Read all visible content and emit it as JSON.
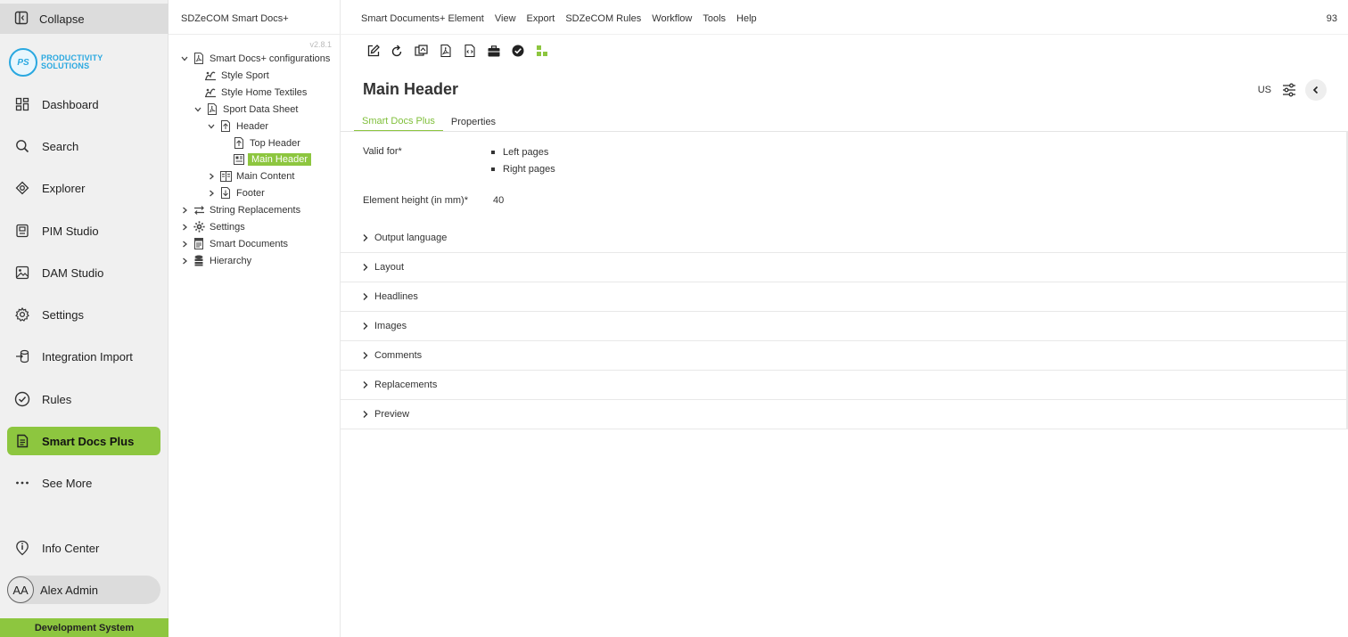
{
  "nav": {
    "collapse_label": "Collapse",
    "logo": {
      "mark": "PS",
      "line1": "PRODUCTIVITY",
      "line2": "SOLUTIONS",
      "color": "#29a8e0"
    },
    "items": [
      {
        "label": "Dashboard",
        "icon": "dashboard-icon"
      },
      {
        "label": "Search",
        "icon": "search-icon"
      },
      {
        "label": "Explorer",
        "icon": "explorer-icon"
      },
      {
        "label": "PIM Studio",
        "icon": "pim-studio-icon"
      },
      {
        "label": "DAM Studio",
        "icon": "image-icon"
      },
      {
        "label": "Settings",
        "icon": "gear-icon"
      },
      {
        "label": "Integration Import",
        "icon": "import-icon"
      },
      {
        "label": "Rules",
        "icon": "check-circle-icon"
      },
      {
        "label": "Smart Docs Plus",
        "icon": "document-icon",
        "active": true
      },
      {
        "label": "See More",
        "icon": "more-icon"
      }
    ],
    "info_center": "Info Center",
    "user": {
      "initials": "AA",
      "name": "Alex Admin"
    },
    "dev_banner": "Development System",
    "accent_color": "#8dc63f"
  },
  "tree": {
    "title": "SDZeCOM Smart Docs+",
    "version": "v2.8.1",
    "nodes": [
      {
        "label": "Smart Docs+ configurations",
        "expanded": true
      },
      {
        "label": "Style Sport"
      },
      {
        "label": "Style Home Textiles"
      },
      {
        "label": "Sport Data Sheet",
        "expanded": true
      },
      {
        "label": "Header",
        "expanded": true
      },
      {
        "label": "Top Header"
      },
      {
        "label": "Main Header",
        "selected": true
      },
      {
        "label": "Main Content",
        "expanded": false
      },
      {
        "label": "Footer",
        "expanded": false
      },
      {
        "label": "String Replacements",
        "expanded": false
      },
      {
        "label": "Settings",
        "expanded": false
      },
      {
        "label": "Smart Documents",
        "expanded": false
      },
      {
        "label": "Hierarchy",
        "expanded": false
      }
    ]
  },
  "menubar": {
    "items": [
      "Smart Documents+ Element",
      "View",
      "Export",
      "SDZeCOM Rules",
      "Workflow",
      "Tools",
      "Help"
    ],
    "counter": "93"
  },
  "toolbar": {
    "buttons": [
      "edit-icon",
      "reload-icon",
      "copy-icon",
      "pdf-icon",
      "code-file-icon",
      "briefcase-icon",
      "check-circle-icon",
      "hierarchy-icon"
    ]
  },
  "page": {
    "title": "Main Header",
    "language": "US",
    "tabs": [
      {
        "label": "Smart Docs Plus",
        "active": true
      },
      {
        "label": "Properties"
      }
    ]
  },
  "form": {
    "valid_for_label": "Valid for*",
    "valid_for_values": [
      "Left pages",
      "Right pages"
    ],
    "height_label": "Element height (in mm)*",
    "height_value": "40"
  },
  "sections": [
    "Output language",
    "Layout",
    "Headlines",
    "Images",
    "Comments",
    "Replacements",
    "Preview"
  ]
}
